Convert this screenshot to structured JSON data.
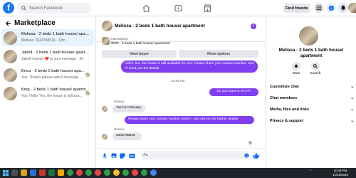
{
  "topbar": {
    "search_placeholder": "Search Facebook",
    "find_friends": "Find friends"
  },
  "sidebar": {
    "title": "Marketplace",
    "chats": [
      {
        "title": "Melissa · 2 beds 1 bath house/ apa...",
        "snippet": "Melissa: 3343798516 · 10m",
        "active": true
      },
      {
        "title": "Jabrill · 2 beds 1 bath house/ apart...",
        "snippet": "Jabrill reacted ❤️ to your message · 2h",
        "active": false
      },
      {
        "title": "Erica · 2 beds 1 bath house/ apa...",
        "snippet": "You: Thanks please wait ill message ...",
        "active": false
      },
      {
        "title": "King · 2 beds 1 bath house/ apartm...",
        "snippet": "You: Hello! Yes, the house is still ava...",
        "active": false
      }
    ]
  },
  "conversation": {
    "title": "Melissa · 2 beds 1 bath house/ apartment",
    "info_label": "i",
    "marketplace_label": "Marketplace",
    "listing_price": "$750 · 2 beds 1 bath house/ apartment",
    "view_buyer": "View buyer",
    "more_options": "More options",
    "messages": {
      "m1": "Hello! Yes, the house is still available for rent. Please share your contact number, and I'll send you the details.",
      "time": "10:40 PM",
      "m2": "Do you want to rent it?",
      "sender1": "Melissa",
      "m3": "Yes for February",
      "m4": "Please share your contact number where I can call you for further details.",
      "sender2": "Melissa",
      "m5": "3343798516"
    },
    "composer_placeholder": "Aa"
  },
  "right_panel": {
    "name": "Melissa · 2 beds 1 bath house/ apartment",
    "mute": "Mute",
    "search": "Search",
    "menu": [
      "Customize chat",
      "Chat members",
      "Media, files and links",
      "Privacy & support"
    ]
  },
  "taskbar": {
    "time": "10:49 PM",
    "date": "12/18/2025"
  },
  "colors": {
    "accent": "#7f3ff0",
    "facebook_blue": "#1877f2",
    "active_row": "#e7f3ff"
  }
}
